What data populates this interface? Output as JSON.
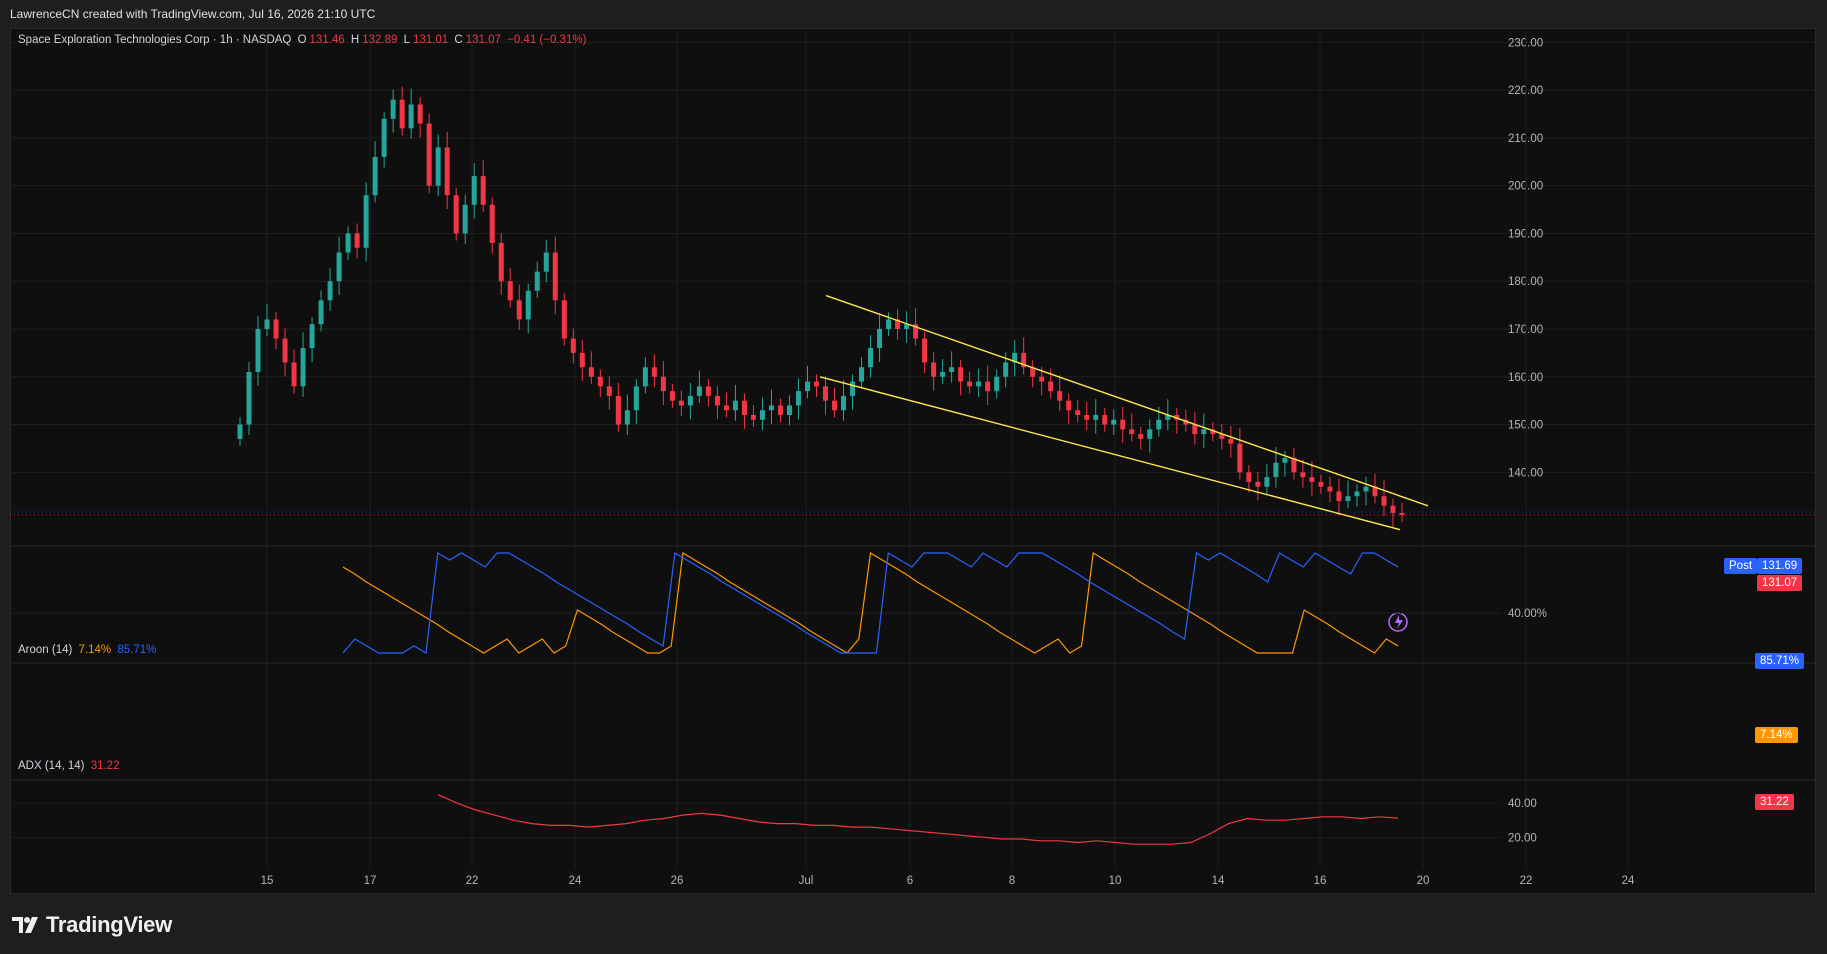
{
  "header": {
    "attribution": "LawrenceCN created with TradingView.com, Jul 16, 2026 21:10 UTC"
  },
  "legend": {
    "symbol": "Space Exploration Technologies Corp · 1h · NASDAQ",
    "o_label": "O",
    "o_value": "131.46",
    "h_label": "H",
    "h_value": "132.89",
    "l_label": "L",
    "l_value": "131.01",
    "c_label": "C",
    "c_value": "131.07",
    "change": "−0.41 (−0.31%)"
  },
  "aroon_legend": {
    "name": "Aroon (14)",
    "down": "7.14%",
    "up": "85.71%"
  },
  "adx_legend": {
    "name": "ADX (14, 14)",
    "value": "31.22"
  },
  "price_tags": {
    "post_label": "Post",
    "post_value": "131.69",
    "last_value": "131.07",
    "aroon_up": "85.71%",
    "aroon_down": "7.14%",
    "adx": "31.22"
  },
  "brand": "TradingView",
  "colors": {
    "up": "#26a69a",
    "down": "#f23645",
    "trendline": "#ffe94d",
    "aroon_up": "#2962ff",
    "aroon_down": "#ff9800",
    "adx": "#f23645",
    "post": "#2962ff"
  },
  "chart_data": [
    {
      "type": "candlestick",
      "ylim": [
        125,
        233
      ],
      "y_ticks": [
        140,
        150,
        160,
        170,
        180,
        190,
        200,
        210,
        220,
        230
      ],
      "x_ticks": [
        "15",
        "17",
        "22",
        "24",
        "26",
        "Jul",
        "6",
        "8",
        "10",
        "14",
        "16",
        "20",
        "22",
        "24"
      ],
      "close_series": [
        150,
        161,
        170,
        172,
        168,
        163,
        158,
        166,
        171,
        176,
        180,
        186,
        190,
        187,
        198,
        206,
        214,
        218,
        212,
        217,
        213,
        200,
        208,
        198,
        190,
        196,
        202,
        196,
        188,
        180,
        176,
        172,
        178,
        182,
        186,
        176,
        168,
        165,
        162,
        160,
        158,
        156,
        150,
        153,
        158,
        162,
        160,
        157,
        155,
        154,
        156,
        158,
        156,
        154,
        153,
        155,
        152,
        151,
        153,
        154,
        152,
        154,
        157,
        159,
        158,
        155,
        153,
        156,
        159,
        162,
        166,
        170,
        172,
        170,
        171,
        168,
        163,
        160,
        161,
        162,
        159,
        158,
        159,
        157,
        160,
        163,
        165,
        162,
        160,
        159,
        157,
        155,
        153,
        152,
        151,
        152,
        150,
        151,
        149,
        148,
        147,
        149,
        151,
        152,
        151,
        150,
        148,
        149,
        148,
        147,
        146,
        140,
        138,
        137,
        139,
        142,
        143,
        140,
        139,
        138,
        137,
        136,
        134,
        135,
        136,
        137,
        135,
        133,
        131.5,
        131.07
      ],
      "trendlines": [
        {
          "from": [
            "Jul",
            177
          ],
          "to": [
            "Jul 18",
            133
          ]
        },
        {
          "from": [
            "Jul",
            160
          ],
          "to": [
            "Jul 18",
            128
          ]
        }
      ],
      "last_price": 131.07,
      "post_price": 131.69
    },
    {
      "type": "line",
      "title": "Aroon (14)",
      "y_ticks": [
        40
      ],
      "series": [
        {
          "name": "Aroon Up",
          "last": 85.71
        },
        {
          "name": "Aroon Down",
          "last": 7.14
        }
      ],
      "up_series": [
        0,
        14,
        7,
        0,
        0,
        0,
        7,
        0,
        100,
        93,
        100,
        93,
        86,
        100,
        100,
        93,
        86,
        79,
        71,
        64,
        57,
        50,
        43,
        36,
        29,
        21,
        14,
        7,
        100,
        93,
        86,
        79,
        71,
        64,
        57,
        50,
        43,
        36,
        29,
        21,
        14,
        7,
        0,
        0,
        0,
        0,
        100,
        93,
        86,
        100,
        100,
        100,
        93,
        86,
        100,
        93,
        86,
        100,
        100,
        100,
        93,
        86,
        79,
        71,
        64,
        57,
        50,
        43,
        36,
        29,
        21,
        14,
        100,
        93,
        100,
        93,
        86,
        79,
        71,
        100,
        93,
        86,
        100,
        93,
        86,
        79,
        100,
        100,
        93,
        86
      ],
      "down_series": [
        86,
        79,
        71,
        64,
        57,
        50,
        43,
        36,
        29,
        21,
        14,
        7,
        0,
        7,
        14,
        0,
        7,
        14,
        0,
        7,
        43,
        36,
        29,
        21,
        14,
        7,
        0,
        0,
        7,
        100,
        93,
        86,
        79,
        71,
        64,
        57,
        50,
        43,
        36,
        29,
        21,
        14,
        7,
        0,
        14,
        100,
        93,
        86,
        79,
        71,
        64,
        57,
        50,
        43,
        36,
        29,
        21,
        14,
        7,
        0,
        7,
        14,
        0,
        7,
        100,
        93,
        86,
        79,
        71,
        64,
        57,
        50,
        43,
        36,
        29,
        21,
        14,
        7,
        0,
        0,
        0,
        0,
        43,
        36,
        29,
        21,
        14,
        7,
        0,
        14,
        7
      ]
    },
    {
      "type": "line",
      "title": "ADX (14, 14)",
      "y_ticks": [
        20,
        40
      ],
      "series": [
        {
          "name": "ADX",
          "last": 31.22
        }
      ],
      "adx_series": [
        45,
        40,
        36,
        33,
        30,
        28,
        27,
        27,
        26,
        27,
        28,
        30,
        31,
        33,
        34,
        33,
        31,
        29,
        28,
        28,
        27,
        27,
        26,
        26,
        25,
        24,
        23,
        22,
        21,
        20,
        19,
        19,
        18,
        18,
        17,
        18,
        17,
        16,
        16,
        16,
        17,
        22,
        28,
        31,
        30,
        30,
        31,
        32,
        32,
        31,
        32,
        31.22
      ]
    }
  ]
}
